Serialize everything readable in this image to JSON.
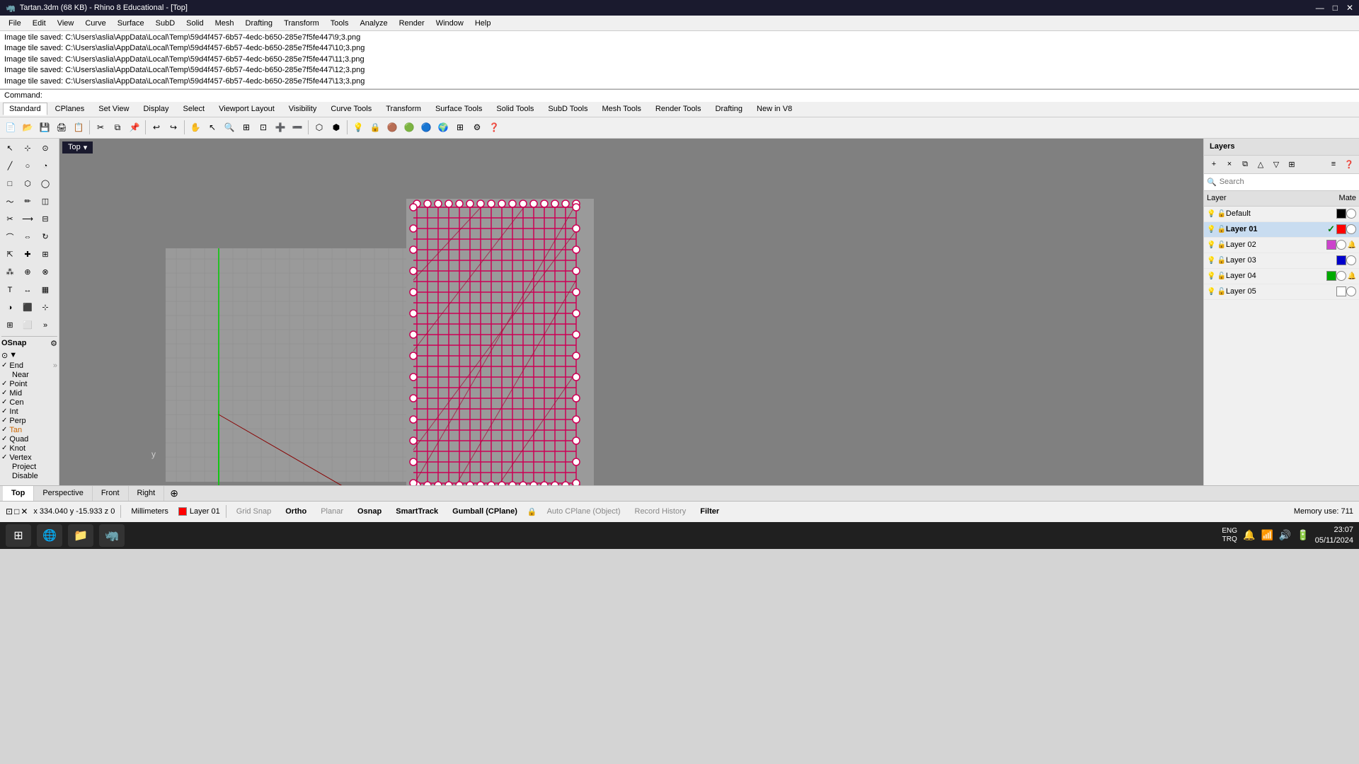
{
  "titlebar": {
    "title": "Tartan.3dm (68 KB) - Rhino 8 Educational - [Top]",
    "icon": "🦏",
    "controls": [
      "—",
      "□",
      "✕"
    ]
  },
  "menubar": {
    "items": [
      "File",
      "Edit",
      "View",
      "Curve",
      "Surface",
      "SubD",
      "Solid",
      "Mesh",
      "Drafting",
      "Transform",
      "Tools",
      "Analyze",
      "Render",
      "Window",
      "Help"
    ]
  },
  "command_output": {
    "lines": [
      "Image tile saved: C:\\Users\\aslia\\AppData\\Local\\Temp\\59d4f457-6b57-4edc-b650-285e7f5fe447\\9;3.png",
      "Image tile saved: C:\\Users\\aslia\\AppData\\Local\\Temp\\59d4f457-6b57-4edc-b650-285e7f5fe447\\10;3.png",
      "Image tile saved: C:\\Users\\aslia\\AppData\\Local\\Temp\\59d4f457-6b57-4edc-b650-285e7f5fe447\\11;3.png",
      "Image tile saved: C:\\Users\\aslia\\AppData\\Local\\Temp\\59d4f457-6b57-4edc-b650-285e7f5fe447\\12;3.png",
      "Image tile saved: C:\\Users\\aslia\\AppData\\Local\\Temp\\59d4f457-6b57-4edc-b650-285e7f5fe447\\13;3.png"
    ],
    "command_label": "Command:"
  },
  "toolbar_tabs": {
    "items": [
      "Standard",
      "CPlanes",
      "Set View",
      "Display",
      "Select",
      "Viewport Layout",
      "Visibility",
      "Curve Tools",
      "Transform",
      "Surface Tools",
      "Solid Tools",
      "SubD Tools",
      "Mesh Tools",
      "Render Tools",
      "Drafting",
      "New in V8"
    ]
  },
  "viewport": {
    "label": "Top",
    "dropdown_arrow": "▾"
  },
  "layers": {
    "header": "Layers",
    "search_placeholder": "Search",
    "col_layer": "Layer",
    "col_mate": "Mate",
    "items": [
      {
        "name": "Default",
        "active": false,
        "checked": false,
        "color": "#000000",
        "visible": true,
        "locked": false
      },
      {
        "name": "Layer 01",
        "active": true,
        "checked": true,
        "color": "#ff0000",
        "visible": true,
        "locked": false
      },
      {
        "name": "Layer 02",
        "active": false,
        "checked": false,
        "color": "#cc44cc",
        "visible": true,
        "locked": false
      },
      {
        "name": "Layer 03",
        "active": false,
        "checked": false,
        "color": "#0000cc",
        "visible": true,
        "locked": false
      },
      {
        "name": "Layer 04",
        "active": false,
        "checked": false,
        "color": "#00aa00",
        "visible": true,
        "locked": false
      },
      {
        "name": "Layer 05",
        "active": false,
        "checked": false,
        "color": "#ffffff",
        "visible": true,
        "locked": false
      }
    ]
  },
  "osnap": {
    "label": "OSnap",
    "items": [
      {
        "name": "End",
        "checked": true
      },
      {
        "name": "Near",
        "checked": false
      },
      {
        "name": "Point",
        "checked": true
      },
      {
        "name": "Mid",
        "checked": true
      },
      {
        "name": "Cen",
        "checked": true
      },
      {
        "name": "Int",
        "checked": true
      },
      {
        "name": "Perp",
        "checked": true
      },
      {
        "name": "Tan",
        "checked": true
      },
      {
        "name": "Quad",
        "checked": true
      },
      {
        "name": "Knot",
        "checked": true
      },
      {
        "name": "Vertex",
        "checked": true
      },
      {
        "name": "Project",
        "checked": false
      },
      {
        "name": "Disable",
        "checked": false
      }
    ]
  },
  "viewport_tabs": {
    "items": [
      "Top",
      "Perspective",
      "Front",
      "Right"
    ],
    "active": "Top"
  },
  "statusbar": {
    "coords": "x 334.040  y -15.933  z 0",
    "units": "Millimeters",
    "layer": "Layer 01",
    "layer_color": "#ff0000",
    "grid_snap": "Grid Snap",
    "ortho": "Ortho",
    "planar": "Planar",
    "osnap": "Osnap",
    "smarttrack": "SmartTrack",
    "gumball": "Gumball (CPlane)",
    "auto_cplane": "Auto CPlane (Object)",
    "record_history": "Record History",
    "filter": "Filter",
    "memory": "Memory use: 711"
  },
  "taskbar": {
    "start_icon": "⊞",
    "apps": [
      "🌐",
      "📁",
      "🦏"
    ],
    "time": "23:07",
    "date": "05/11/2024",
    "keyboard": "ENG\nTRQ"
  }
}
